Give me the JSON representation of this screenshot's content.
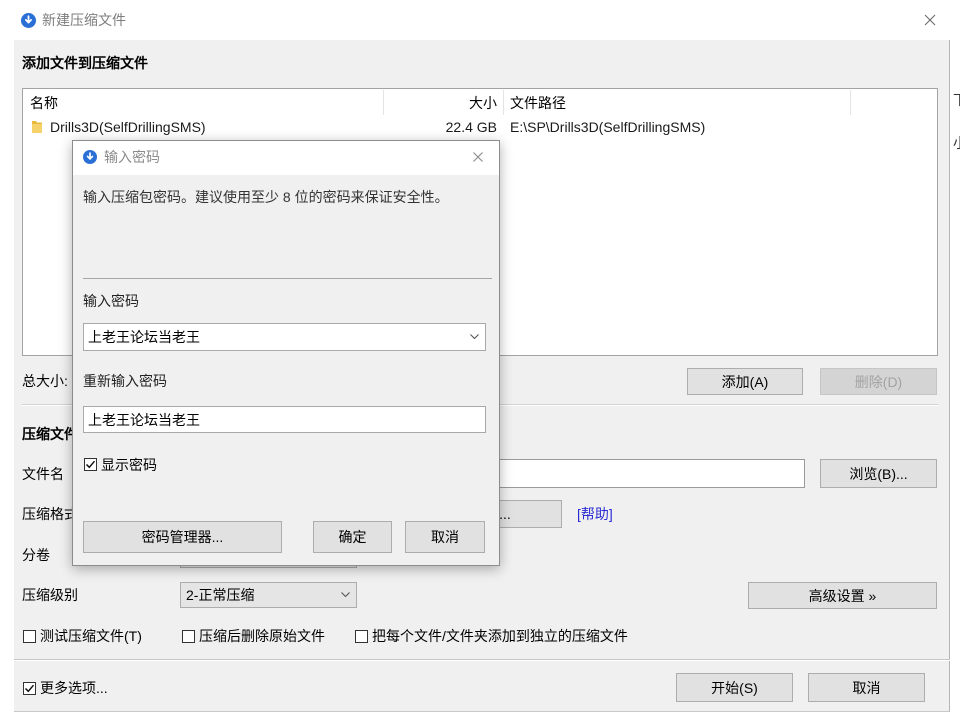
{
  "window": {
    "title": "新建压缩文件"
  },
  "add_section": {
    "heading": "添加文件到压缩文件",
    "columns": {
      "name": "名称",
      "size": "大小",
      "path": "文件路径"
    },
    "rows": [
      {
        "name": "Drills3D(SelfDrillingSMS)",
        "size": "22.4 GB",
        "path": "E:\\SP\\Drills3D(SelfDrillingSMS)"
      }
    ],
    "total_size_label": "总大小:",
    "add_button": "添加(A)",
    "delete_button": "删除(D)"
  },
  "archive_section": {
    "heading": "压缩文件",
    "filename_label": "文件名",
    "browse_button": "浏览(B)...",
    "format_label": "压缩格式",
    "format_more_button": "...",
    "help_link": "[帮助]",
    "volume_label": "分卷",
    "level_label": "压缩级别",
    "level_value": "2-正常压缩",
    "advanced_button": "高级设置 »",
    "options": [
      {
        "label": "测试压缩文件(T)",
        "checked": false
      },
      {
        "label": "压缩后删除原始文件",
        "checked": false
      },
      {
        "label": "把每个文件/文件夹添加到独立的压缩文件",
        "checked": false
      }
    ]
  },
  "footer": {
    "more_options": {
      "label": "更多选项...",
      "checked": true
    },
    "start_button": "开始(S)",
    "cancel_button": "取消"
  },
  "password_dialog": {
    "title": "输入密码",
    "description": "输入压缩包密码。建议使用至少 8 位的密码来保证安全性。",
    "password_label": "输入密码",
    "password_value": "上老王论坛当老王",
    "confirm_label": "重新输入密码",
    "confirm_value": "上老王论坛当老王",
    "show_password": {
      "label": "显示密码",
      "checked": true
    },
    "manager_button": "密码管理器...",
    "ok_button": "确定",
    "cancel_button": "取消"
  },
  "background_window": {
    "glyphs": [
      "下",
      "小"
    ]
  },
  "icons": {
    "app": "app-logo-icon",
    "close": "close-icon",
    "folder": "folder-icon",
    "dropdown": "chevron-down-icon",
    "check": "check-icon"
  },
  "colors": {
    "accent": "#2a6fd6",
    "link": "#2b2bd3",
    "panel": "#f0f0f0"
  }
}
